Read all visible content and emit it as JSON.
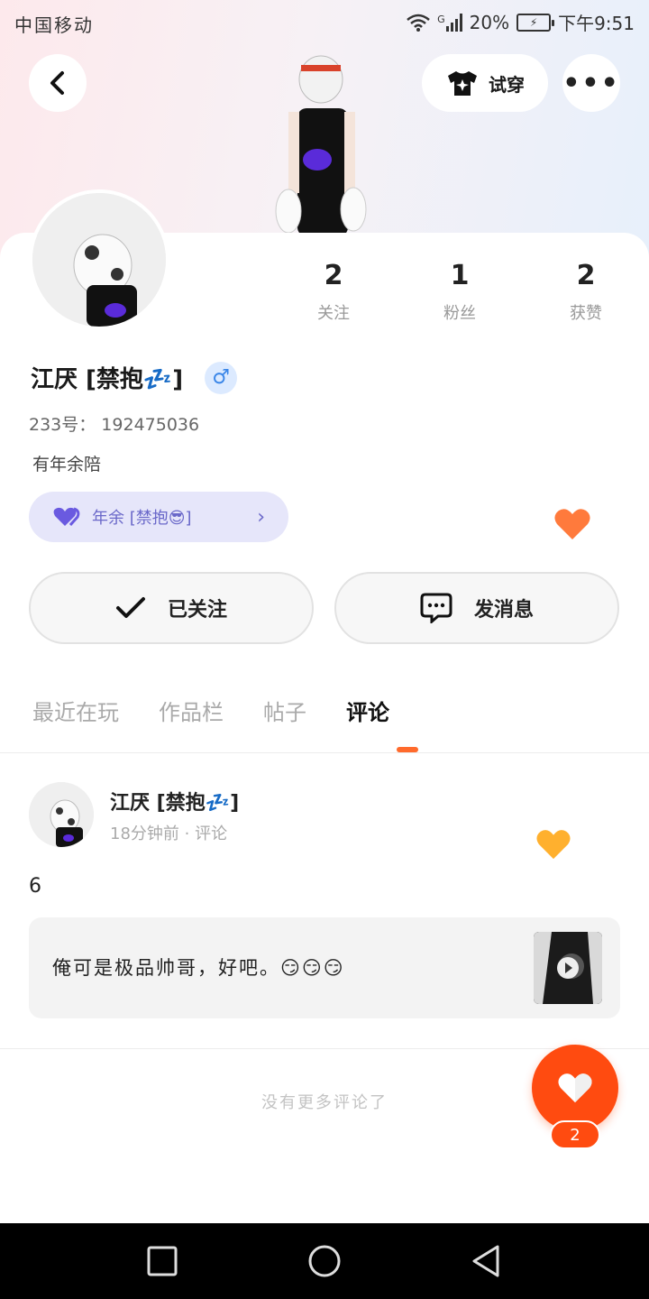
{
  "status_bar": {
    "carrier": "中国移动",
    "network": "G",
    "battery": "20%",
    "time": "下午9:51"
  },
  "header": {
    "tryon_label": "试穿"
  },
  "profile": {
    "nickname": "江厌 [禁抱💤]",
    "gender_symbol": "♂",
    "uid": "233号： 192475036",
    "bio": "有年余陪",
    "cp_tag": "年余 [禁抱😎]",
    "stats": [
      {
        "value": "2",
        "label": "关注"
      },
      {
        "value": "1",
        "label": "粉丝"
      },
      {
        "value": "2",
        "label": "获赞"
      }
    ]
  },
  "actions": {
    "follow_label": "已关注",
    "message_label": "发消息"
  },
  "tabs": [
    {
      "label": "最近在玩"
    },
    {
      "label": "作品栏"
    },
    {
      "label": "帖子"
    },
    {
      "label": "评论"
    }
  ],
  "active_tab": "评论",
  "comment": {
    "author": "江厌 [禁抱💤]",
    "meta": "18分钟前 · 评论",
    "text": "6",
    "quote": "俺可是极品帅哥，好吧。😏😏😏"
  },
  "footer": {
    "no_more": "没有更多评论了"
  },
  "fab": {
    "count": "2"
  },
  "colors": {
    "accent": "#ff4b10",
    "cp_tag_bg": "#e6e6fa",
    "cp_tag_text": "#6a68c9",
    "heart_orange": "#ff7a3c",
    "heart_yellow": "#ffb02e"
  },
  "icons": {
    "back": "chevron-left-icon",
    "tryon": "tshirt-icon",
    "more": "more-dots-icon",
    "gender": "male-icon",
    "cp": "purple-heart-icon",
    "follow": "check-icon",
    "message": "chat-bubble-icon",
    "like": "heart-icon"
  }
}
